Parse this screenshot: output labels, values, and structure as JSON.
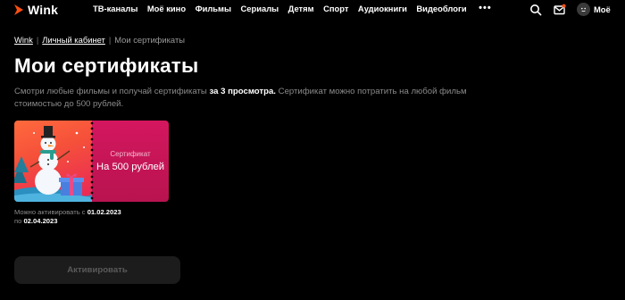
{
  "header": {
    "logo_text": "Wink",
    "nav": [
      "ТВ-каналы",
      "Моё кино",
      "Фильмы",
      "Сериалы",
      "Детям",
      "Спорт",
      "Аудиокниги",
      "Видеоблоги"
    ],
    "more_label": "•••",
    "profile_label": "Моё",
    "accent_color": "#ff4f12"
  },
  "breadcrumb": {
    "home": "Wink",
    "account": "Личный кабинет",
    "separator": "|",
    "current": "Мои сертификаты"
  },
  "page": {
    "title": "Мои сертификаты",
    "description_part1": "Смотри любые фильмы и получай сертификаты ",
    "description_bold": "за 3 просмотра.",
    "description_part2": " Сертификат можно потратить на любой фильм стоимостью до 500 рублей."
  },
  "certificate": {
    "label": "Сертификат",
    "value": "На 500 рублей",
    "image_icon": "snowman-illustration",
    "colors": {
      "primary": "#d4175f",
      "image_gradient": "#f5503a"
    },
    "activation_prefix": "Можно активировать с ",
    "activation_from": "01.02.2023",
    "activation_to_prefix": "по ",
    "activation_to": "02.04.2023"
  },
  "actions": {
    "activate_label": "Активировать",
    "activate_enabled": false
  }
}
